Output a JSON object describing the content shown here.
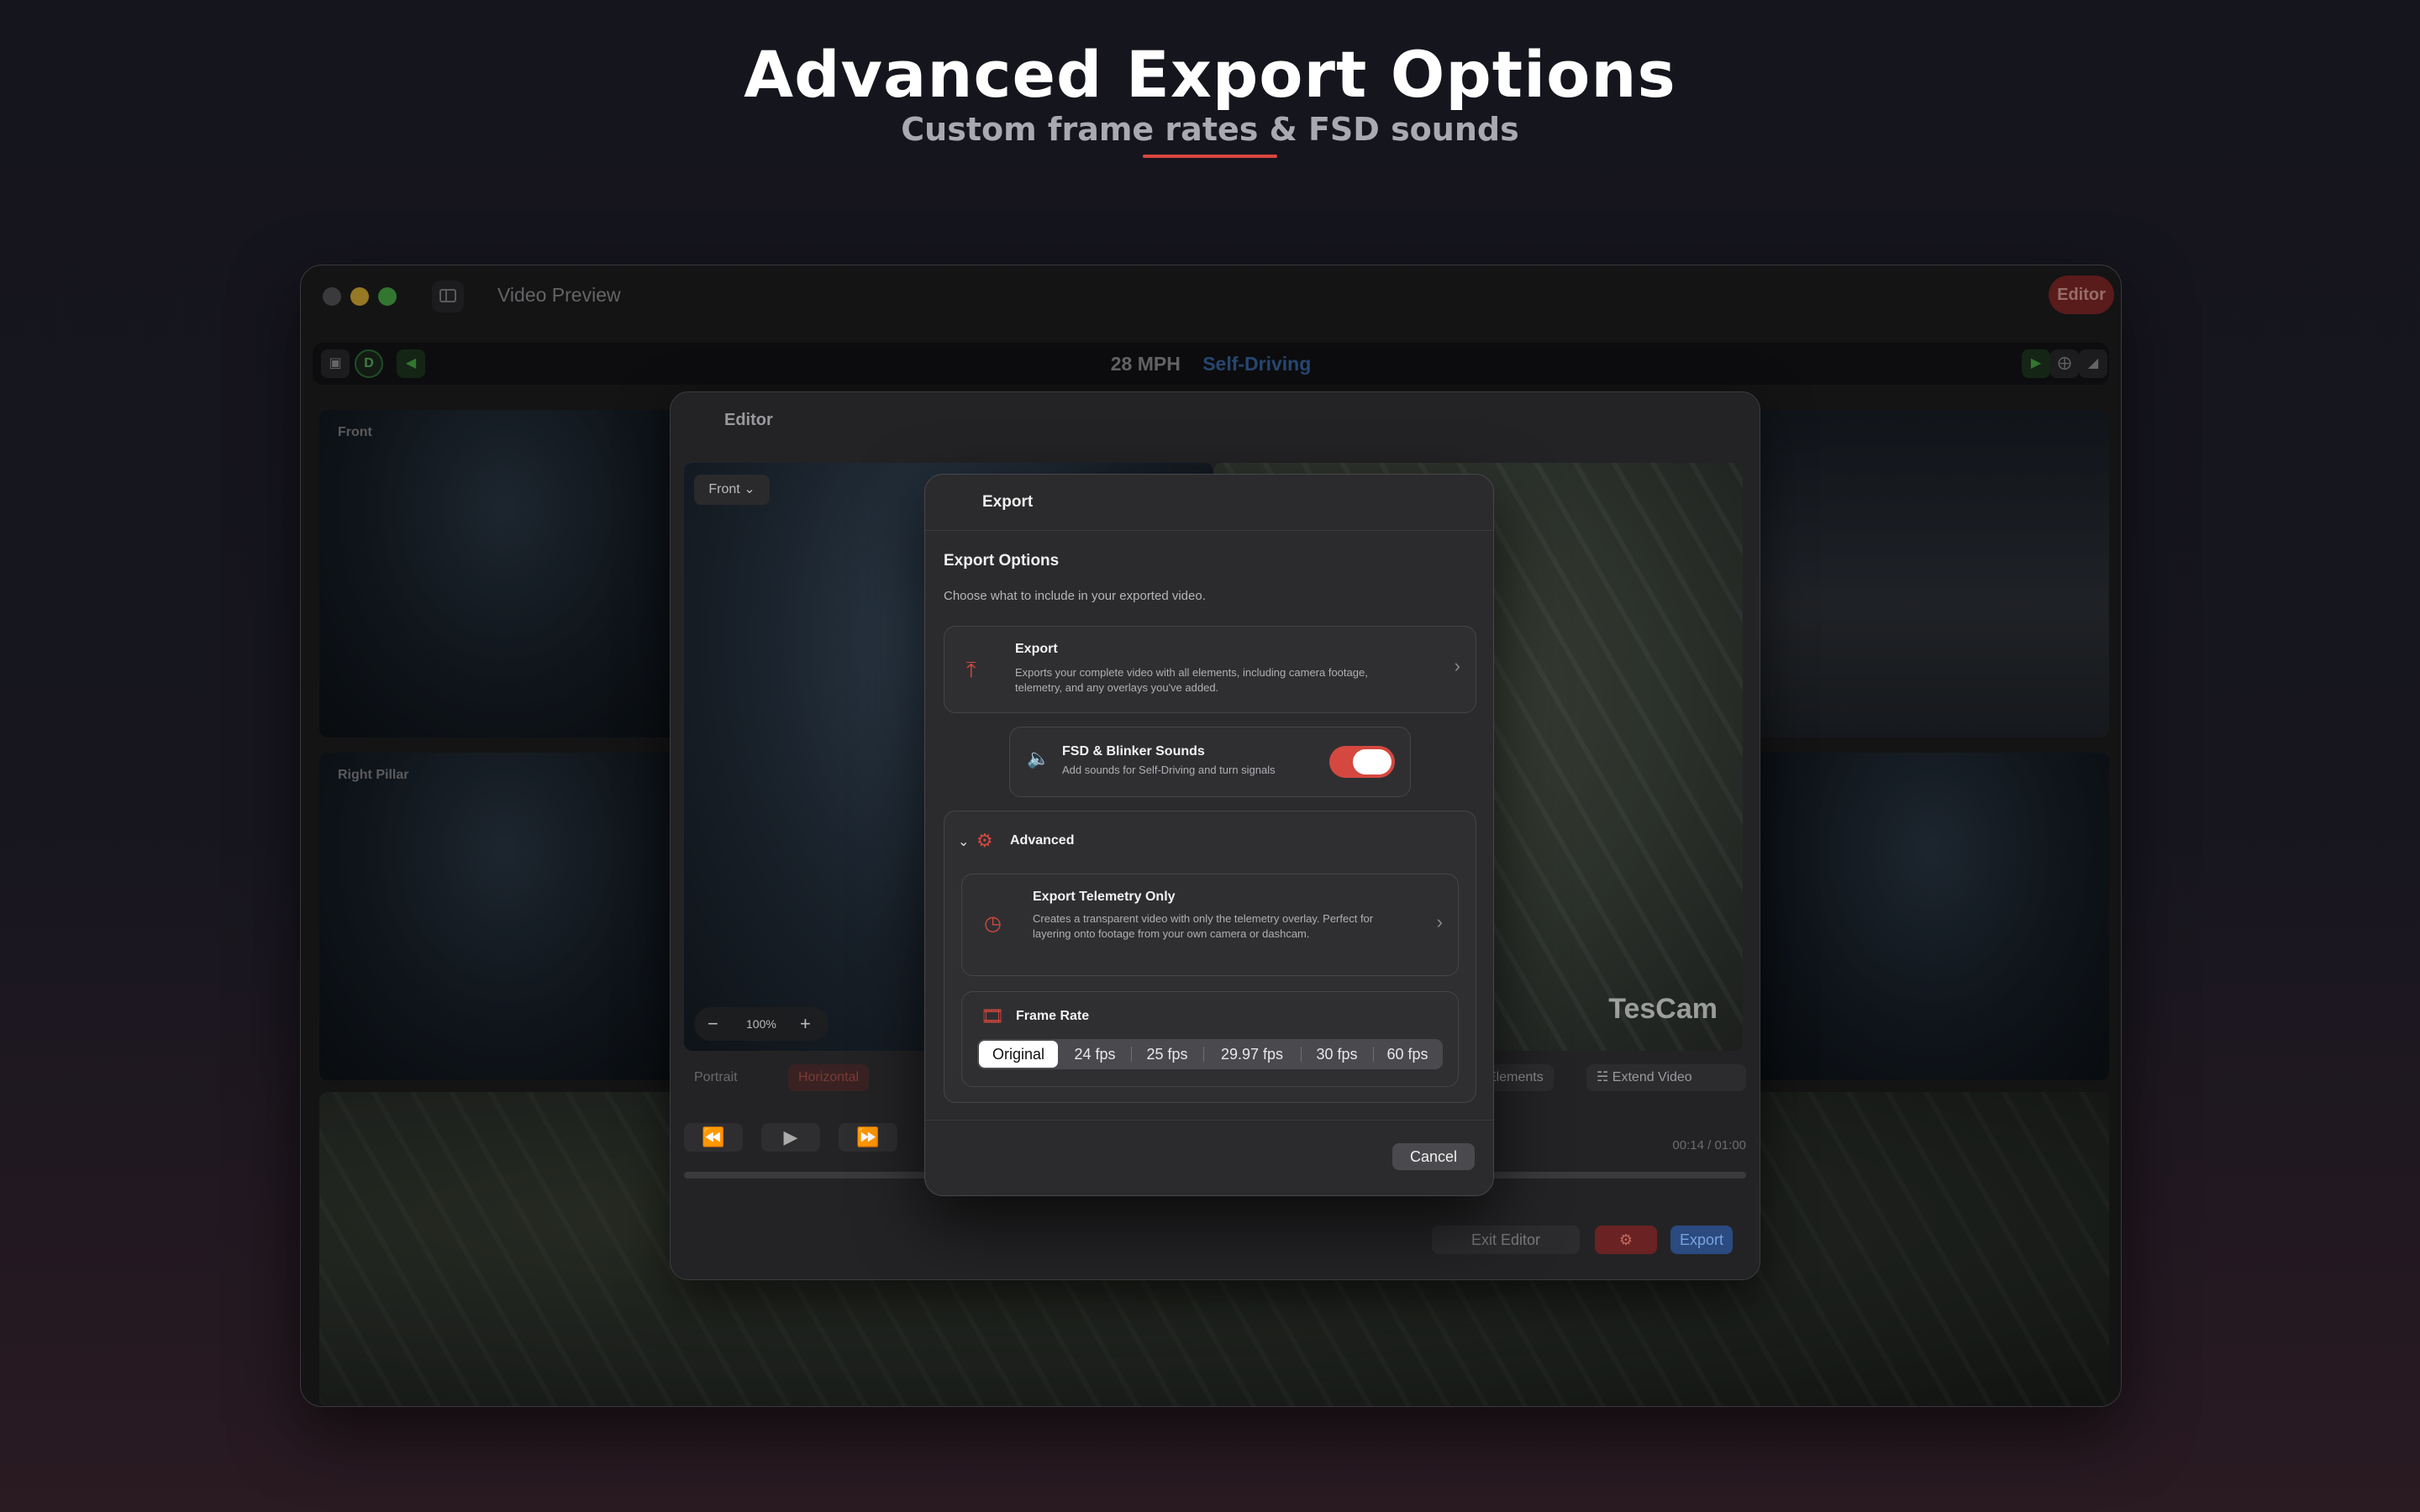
{
  "hero": {
    "title": "Advanced Export Options",
    "subtitle": "Custom frame rates & FSD sounds"
  },
  "window": {
    "title": "Video Preview",
    "mode_pill": "Editor",
    "toolbar": {
      "gear_label": "D",
      "speed": "28 MPH",
      "mode": "Self-Driving"
    },
    "cameras": [
      {
        "label": "Front"
      },
      {
        "label": "Right Pillar"
      }
    ]
  },
  "editor": {
    "title": "Editor",
    "camera_select": "Front",
    "zoom": "100%",
    "watermark": "TesCam",
    "orientation": [
      "Portrait",
      "Horizontal"
    ],
    "tools": [
      "Elements",
      "Extend Video"
    ],
    "time": "00:14 / 01:00",
    "footer": {
      "exit": "Exit Editor",
      "export": "Export"
    }
  },
  "export_dialog": {
    "title": "Export",
    "heading": "Export Options",
    "subheading": "Choose what to include in your exported video.",
    "export_card": {
      "title": "Export",
      "desc": "Exports your complete video with all elements, including camera footage, telemetry, and any overlays you've added."
    },
    "sounds": {
      "title": "FSD & Blinker Sounds",
      "desc": "Add sounds for Self-Driving and turn signals",
      "enabled": true
    },
    "advanced": {
      "label": "Advanced",
      "telemetry": {
        "title": "Export Telemetry Only",
        "desc": "Creates a transparent video with only the telemetry overlay. Perfect for layering onto footage from your own camera or dashcam."
      },
      "frame_rate": {
        "label": "Frame Rate",
        "options": [
          "Original",
          "24 fps",
          "25 fps",
          "29.97 fps",
          "30 fps",
          "60 fps"
        ],
        "selected": "Original"
      }
    },
    "cancel": "Cancel"
  },
  "colors": {
    "accent_red": "#d4483f",
    "self_driving_blue": "#3d6fb0"
  }
}
